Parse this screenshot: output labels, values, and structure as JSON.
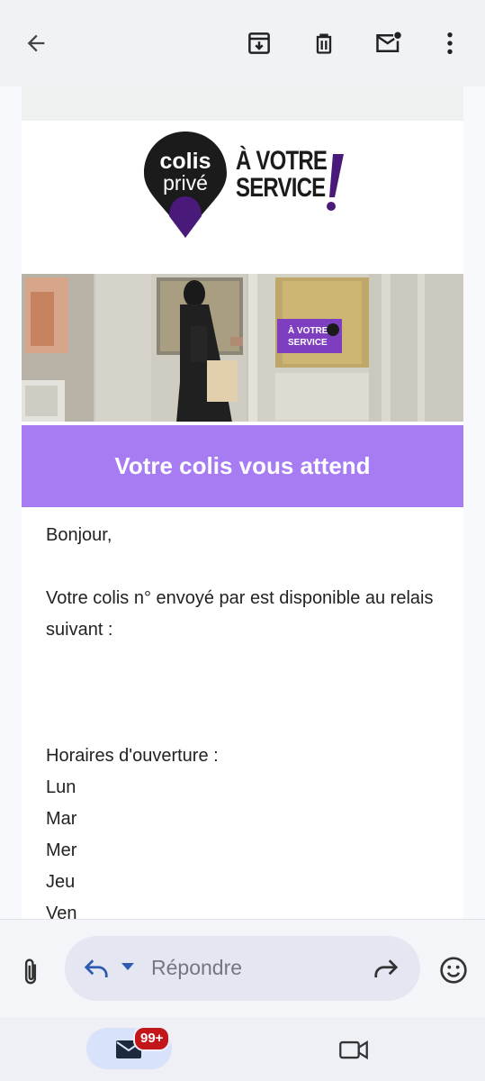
{
  "toolbar": {
    "back_icon": "arrow-left-icon",
    "archive_icon": "archive-icon",
    "delete_icon": "trash-icon",
    "mark_unread_icon": "mail-unread-icon",
    "more_icon": "more-vertical-icon"
  },
  "email": {
    "logo": {
      "brand_line1": "colis",
      "brand_line2": "privé",
      "slogan_line1": "À VOTRE",
      "slogan_line2": "SERVICE",
      "slogan_mark": "!"
    },
    "hero_sign": {
      "line1": "À VOTRE",
      "line2": "SERVICE"
    },
    "banner_title": "Votre colis vous attend",
    "greeting": "Bonjour,",
    "message": "Votre colis n° envoyé par est disponible au relais suivant :",
    "hours_label": "Horaires d'ouverture :",
    "days": [
      "Lun",
      "Mar",
      "Mer",
      "Jeu",
      "Ven"
    ],
    "colors": {
      "banner": "#a77bf2",
      "brand_purple": "#4a1a7a",
      "brand_dark": "#1b1b1b"
    }
  },
  "reply_bar": {
    "attach_icon": "paperclip-icon",
    "reply_icon": "reply-icon",
    "reply_placeholder": "Répondre",
    "forward_icon": "forward-icon",
    "emoji_icon": "emoji-icon"
  },
  "bottom_nav": {
    "mail_icon": "mail-icon",
    "mail_badge": "99+",
    "meet_icon": "video-camera-icon"
  }
}
